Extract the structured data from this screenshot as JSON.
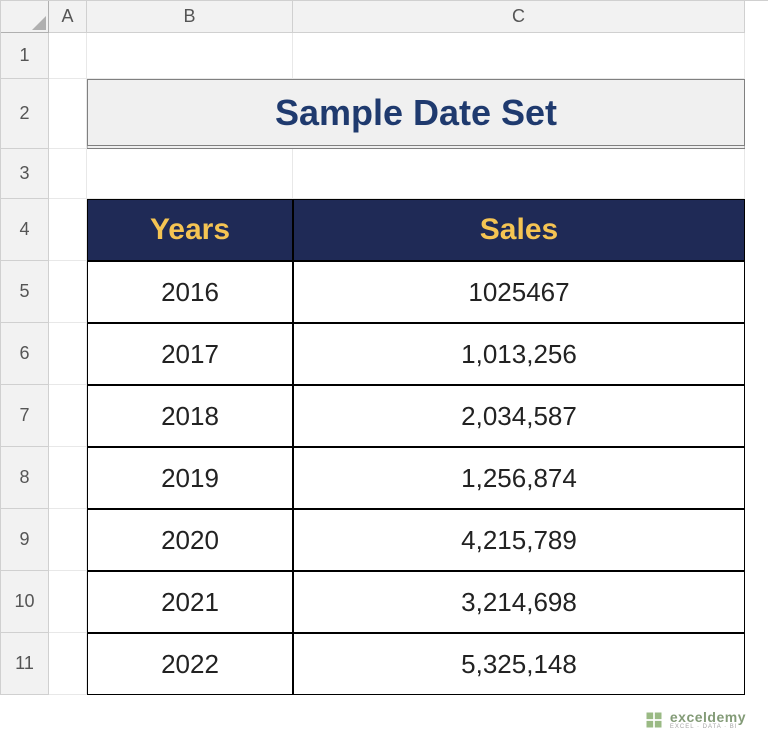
{
  "columns": [
    "A",
    "B",
    "C"
  ],
  "rows": [
    "1",
    "2",
    "3",
    "4",
    "5",
    "6",
    "7",
    "8",
    "9",
    "10",
    "11"
  ],
  "title": "Sample Date Set",
  "table": {
    "headers": {
      "years": "Years",
      "sales": "Sales"
    },
    "data": [
      {
        "year": "2016",
        "sales": "1025467"
      },
      {
        "year": "2017",
        "sales": "1,013,256"
      },
      {
        "year": "2018",
        "sales": "2,034,587"
      },
      {
        "year": "2019",
        "sales": "1,256,874"
      },
      {
        "year": "2020",
        "sales": "4,215,789"
      },
      {
        "year": "2021",
        "sales": "3,214,698"
      },
      {
        "year": "2022",
        "sales": "5,325,148"
      }
    ]
  },
  "watermark": {
    "brand": "exceldemy",
    "tag": "EXCEL · DATA · BI"
  }
}
